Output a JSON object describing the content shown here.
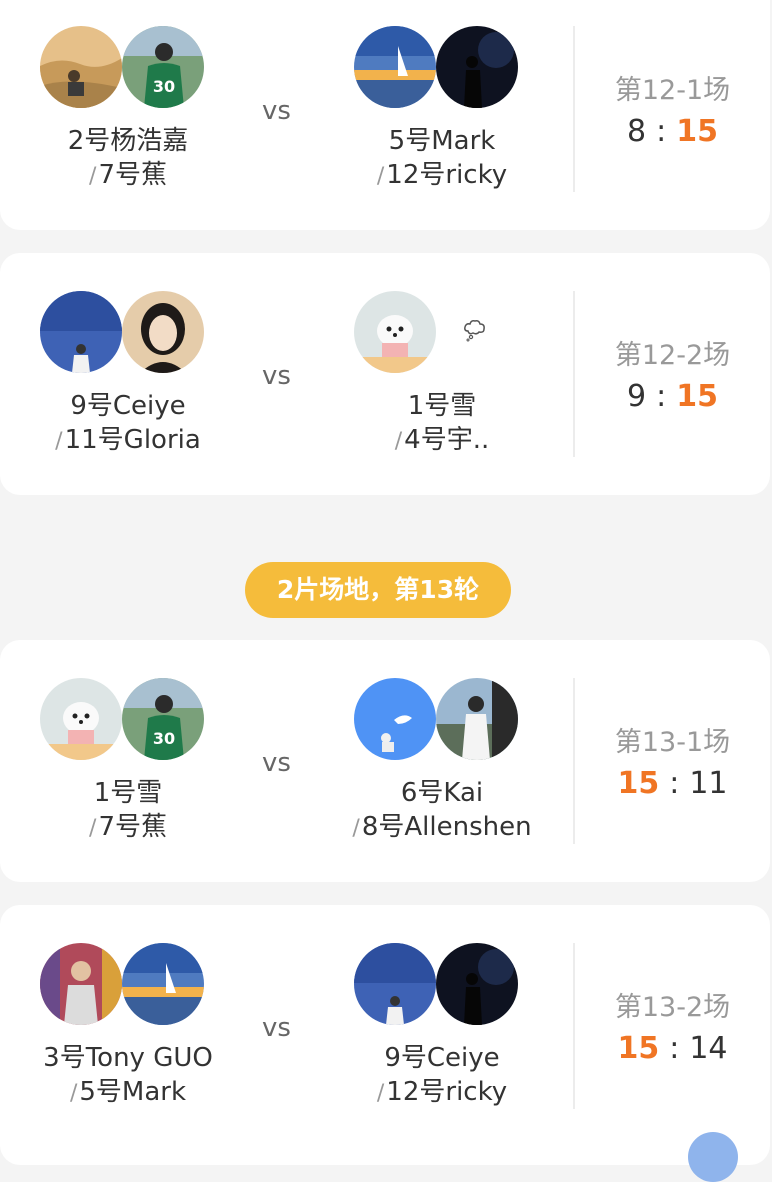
{
  "matches": [
    {
      "team_a": {
        "p1": "2号杨浩嘉",
        "p2": "7号蕉",
        "slash": "/"
      },
      "vs": "vs",
      "team_b": {
        "p1": "5号Mark",
        "p2": "12号ricky",
        "slash": "/"
      },
      "match_label": "第12-1场",
      "score_a": "8",
      "score_b": "15",
      "colon": ":"
    },
    {
      "team_a": {
        "p1": "9号Ceiye",
        "p2": "11号Gloria",
        "slash": "/"
      },
      "vs": "vs",
      "team_b": {
        "p1": "1号雪",
        "p2": "4号宇..",
        "slash": "/"
      },
      "match_label": "第12-2场",
      "score_a": "9",
      "score_b": "15",
      "colon": ":"
    },
    {
      "team_a": {
        "p1": "1号雪",
        "p2": "7号蕉",
        "slash": "/"
      },
      "vs": "vs",
      "team_b": {
        "p1": "6号Kai",
        "p2": "8号Allenshen",
        "slash": "/"
      },
      "match_label": "第13-1场",
      "score_a": "15",
      "score_b": "11",
      "colon": ":"
    },
    {
      "team_a": {
        "p1": "3号Tony GUO",
        "p2": "5号Mark",
        "slash": "/"
      },
      "vs": "vs",
      "team_b": {
        "p1": "9号Ceiye",
        "p2": "12号ricky",
        "slash": "/"
      },
      "match_label": "第13-2场",
      "score_a": "15",
      "score_b": "14",
      "colon": ":"
    }
  ],
  "round_badge": "2片场地，第13轮",
  "colors": {
    "win": "#f07524",
    "badge": "#f5bc3b",
    "background": "#f4f4f4"
  },
  "icons": {
    "dream": "thinking-cloud-icon"
  }
}
